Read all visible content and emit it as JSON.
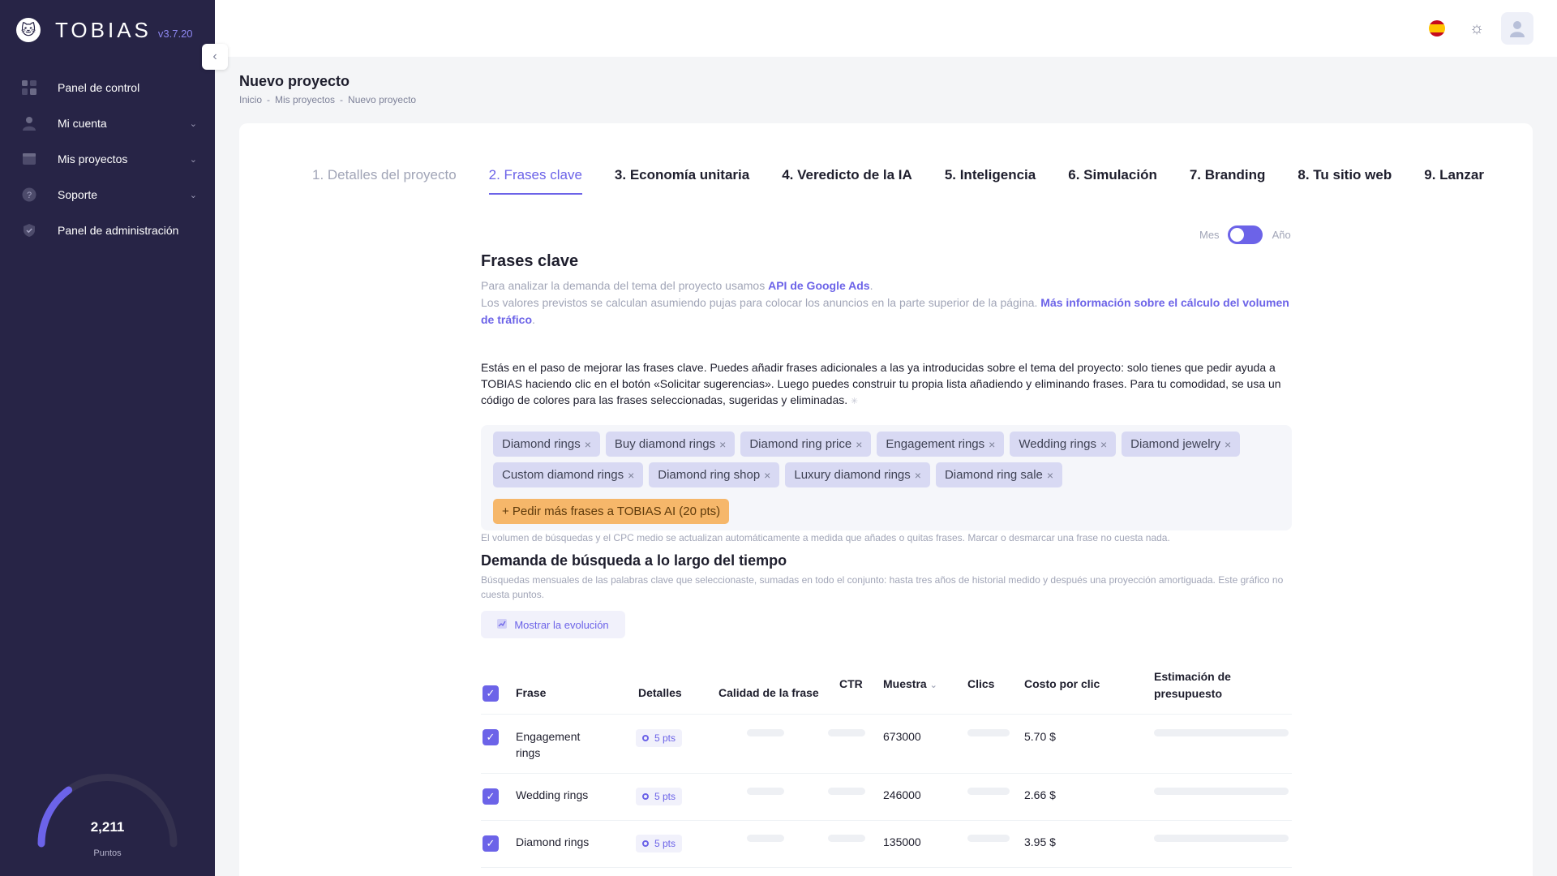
{
  "sidebar": {
    "brand": "TOBIAS",
    "version": "v3.7.20",
    "items": [
      {
        "label": "Panel de control",
        "icon": "dashboard-icon",
        "has_children": false
      },
      {
        "label": "Mi cuenta",
        "icon": "user-icon",
        "has_children": true
      },
      {
        "label": "Mis proyectos",
        "icon": "projects-icon",
        "has_children": true
      },
      {
        "label": "Soporte",
        "icon": "help-icon",
        "has_children": true
      },
      {
        "label": "Panel de administración",
        "icon": "shield-icon",
        "has_children": false
      }
    ],
    "points": {
      "value": "2,211",
      "label": "Puntos",
      "fill_fraction": 0.3
    }
  },
  "header": {
    "language": "es",
    "theme": "light"
  },
  "page": {
    "title": "Nuevo proyecto",
    "breadcrumb": [
      "Inicio",
      "-",
      "Mis proyectos",
      "-",
      "Nuevo proyecto"
    ]
  },
  "steps": [
    {
      "label": "1. Detalles del proyecto",
      "state": "done"
    },
    {
      "label": "2. Frases clave",
      "state": "active"
    },
    {
      "label": "3. Economía unitaria",
      "state": "pending"
    },
    {
      "label": "4. Veredicto de la IA",
      "state": "pending"
    },
    {
      "label": "5. Inteligencia",
      "state": "pending"
    },
    {
      "label": "6. Simulación",
      "state": "pending"
    },
    {
      "label": "7. Branding",
      "state": "pending"
    },
    {
      "label": "8. Tu sitio web",
      "state": "pending"
    },
    {
      "label": "9. Lanzar",
      "state": "pending"
    }
  ],
  "period_toggle": {
    "left": "Mes",
    "right": "Año"
  },
  "keywords": {
    "title": "Frases clave",
    "intro_1": "Para analizar la demanda del tema del proyecto usamos ",
    "intro_link_1": "API de Google Ads",
    "intro_1_end": ".",
    "intro_2": "Los valores previstos se calculan asumiendo pujas para colocar los anuncios en la parte superior de la página. ",
    "intro_link_2": "Más información sobre el cálculo del volumen de tráfico",
    "intro_2_end": ".",
    "description": "Estás en el paso de mejorar las frases clave. Puedes añadir frases adicionales a las ya introducidas sobre el tema del proyecto: solo tienes que pedir ayuda a TOBIAS haciendo clic en el botón «Solicitar sugerencias». Luego puedes construir tu propia lista añadiendo y eliminando frases. Para tu comodidad, se usa un código de colores para las frases seleccionadas, sugeridas y eliminadas.",
    "tags": [
      "Diamond rings",
      "Buy diamond rings",
      "Diamond ring price",
      "Engagement rings",
      "Wedding rings",
      "Diamond jewelry",
      "Custom diamond rings",
      "Diamond ring shop",
      "Luxury diamond rings",
      "Diamond ring sale"
    ],
    "ask_button": "+ Pedir más frases a TOBIAS AI (20 pts)",
    "note": "El volumen de búsquedas y el CPC medio se actualizan automáticamente a medida que añades o quitas frases. Marcar o desmarcar una frase no cuesta nada."
  },
  "demand": {
    "title": "Demanda de búsqueda a lo largo del tiempo",
    "description": "Búsquedas mensuales de las palabras clave que seleccionaste, sumadas en todo el conjunto: hasta tres años de historial medido y después una proyección amortiguada. Este gráfico no cuesta puntos.",
    "button": "Mostrar la evolución"
  },
  "table": {
    "headers": {
      "frase": "Frase",
      "detalles": "Detalles",
      "calidad": "Calidad de la frase",
      "ctr": "CTR",
      "muestra": "Muestra",
      "clics": "Clics",
      "cpc": "Costo por clic",
      "estimacion": "Estimación de presupuesto"
    },
    "rows": [
      {
        "frase": "Engagement rings",
        "detalles": "5 pts",
        "muestra": "673000",
        "cpc": "5.70 $"
      },
      {
        "frase": "Wedding rings",
        "detalles": "5 pts",
        "muestra": "246000",
        "cpc": "2.66 $"
      },
      {
        "frase": "Diamond rings",
        "detalles": "5 pts",
        "muestra": "135000",
        "cpc": "3.95 $"
      }
    ]
  },
  "colors": {
    "accent": "#6c63e8",
    "sidebar": "#272446",
    "tag": "#d8d9f3",
    "ask": "#f6b76a"
  }
}
